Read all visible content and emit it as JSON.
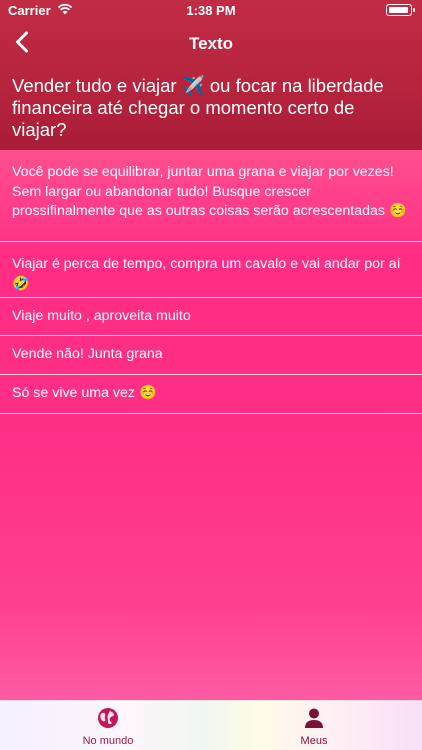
{
  "status_bar": {
    "carrier": "Carrier",
    "time": "1:38 PM"
  },
  "nav": {
    "title": "Texto",
    "back_icon": "chevron-left-icon"
  },
  "question": "Vender tudo e viajar ✈️ ou focar na liberdade financeira até chegar o momento certo de viajar?",
  "answers": [
    {
      "text": "Você pode se equilibrar, juntar uma grana e viajar por vezes! Sem largar ou abandonar tudo! Busque crescer prossifinalmente que as outras coisas serão acrescentadas ☺️"
    },
    {
      "text": "Viajar é perca de tempo, compra um cavalo e vai andar por aí 🤣"
    },
    {
      "text": "Viaje muito , aproveita muito"
    },
    {
      "text": "Vende não! Junta grana"
    },
    {
      "text": "Só se vive uma vez ☺️"
    }
  ],
  "tabs": [
    {
      "label": "No mundo",
      "icon": "globe-icon"
    },
    {
      "label": "Meus",
      "icon": "person-icon"
    }
  ],
  "colors": {
    "header": "#b7243d",
    "accent": "#ff2d84",
    "tab_active": "#7a1238"
  }
}
